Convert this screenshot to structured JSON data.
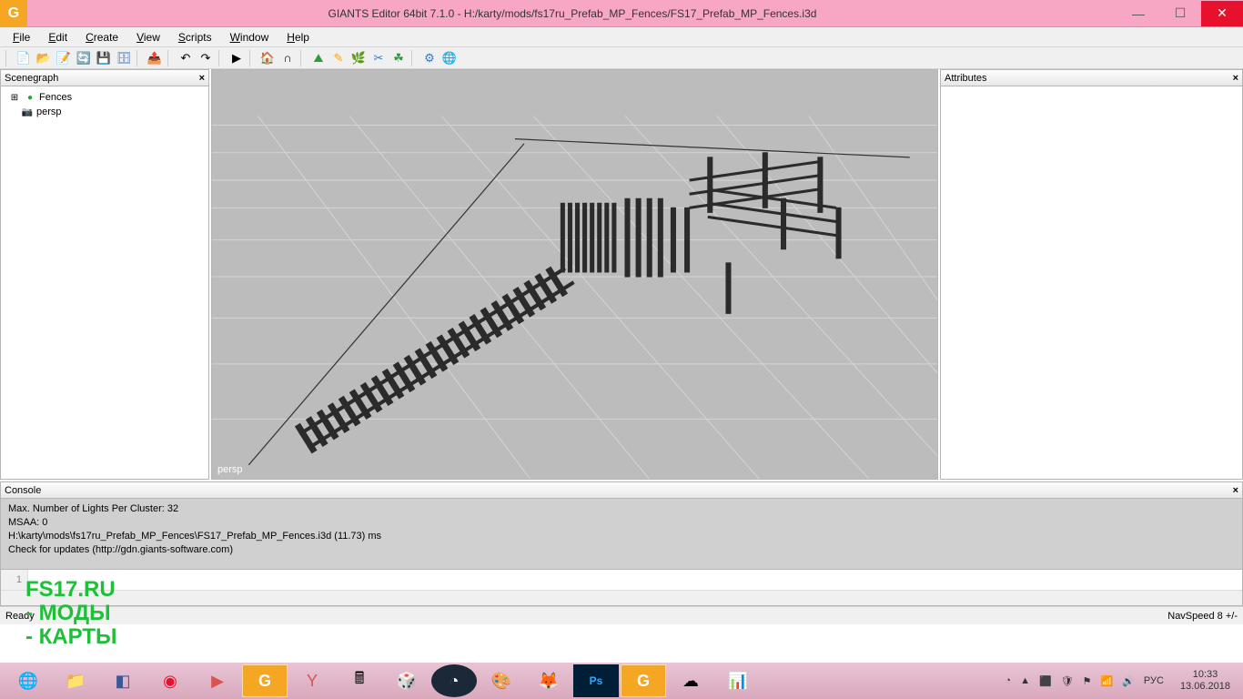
{
  "titlebar": {
    "title": "GIANTS Editor 64bit 7.1.0 - H:/karty/mods/fs17ru_Prefab_MP_Fences/FS17_Prefab_MP_Fences.i3d"
  },
  "menu": {
    "file": "File",
    "edit": "Edit",
    "create": "Create",
    "view": "View",
    "scripts": "Scripts",
    "window": "Window",
    "help": "Help"
  },
  "panels": {
    "scenegraph_title": "Scenegraph",
    "attributes_title": "Attributes",
    "console_title": "Console"
  },
  "scenegraph": {
    "items": [
      {
        "icon": "⊞",
        "label": "Fences"
      },
      {
        "icon": "📷",
        "label": "persp"
      }
    ]
  },
  "viewport": {
    "camera_label": "persp"
  },
  "console": {
    "l1": "Max. Number of Lights Per Cluster: 32",
    "l2": "MSAA: 0",
    "l3": "H:\\karty\\mods\\fs17ru_Prefab_MP_Fences\\FS17_Prefab_MP_Fences.i3d (11.73) ms",
    "l4": "Check for updates (http://gdn.giants-software.com)",
    "input_line": "1"
  },
  "status": {
    "left": "Ready",
    "right": "NavSpeed 8 +/-"
  },
  "tray": {
    "lang": "РУС",
    "time": "10:33",
    "date": "13.06.2018"
  },
  "watermark": {
    "l1": "FS17.RU",
    "l2": "- МОДЫ",
    "l3": "- КАРТЫ"
  }
}
